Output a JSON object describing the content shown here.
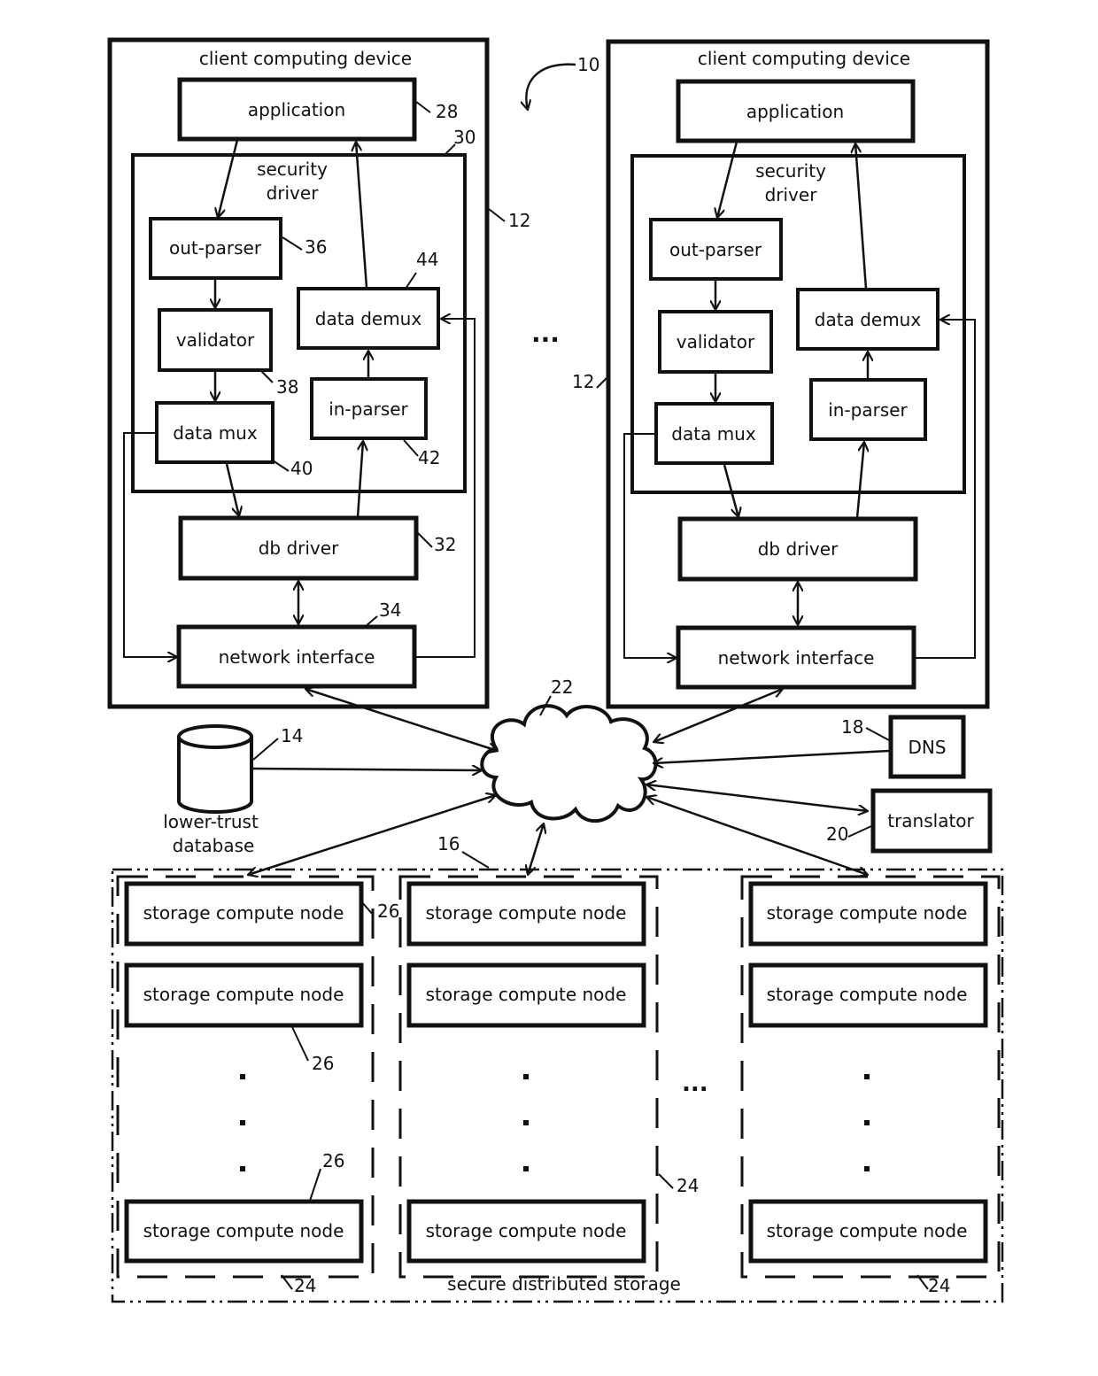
{
  "figure_ref": "10",
  "client_left": {
    "title": "client computing device",
    "ref": "12",
    "application": {
      "label": "application",
      "ref": "28"
    },
    "security_driver": {
      "label_line1": "security",
      "label_line2": "driver",
      "ref": "30"
    },
    "out_parser": {
      "label": "out-parser",
      "ref": "36"
    },
    "validator": {
      "label": "validator",
      "ref": "38"
    },
    "data_mux": {
      "label": "data mux",
      "ref": "40"
    },
    "in_parser": {
      "label": "in-parser",
      "ref": "42"
    },
    "data_demux": {
      "label": "data demux",
      "ref": "44"
    },
    "db_driver": {
      "label": "db driver",
      "ref": "32"
    },
    "network_interface": {
      "label": "network interface",
      "ref": "34"
    }
  },
  "client_right": {
    "title": "client computing device",
    "ref": "12",
    "application": {
      "label": "application"
    },
    "security_driver": {
      "label_line1": "security",
      "label_line2": "driver"
    },
    "out_parser": {
      "label": "out-parser"
    },
    "validator": {
      "label": "validator"
    },
    "data_mux": {
      "label": "data mux"
    },
    "in_parser": {
      "label": "in-parser"
    },
    "data_demux": {
      "label": "data demux"
    },
    "db_driver": {
      "label": "db driver"
    },
    "network_interface": {
      "label": "network interface"
    }
  },
  "ellipsis": "...",
  "network": {
    "ref": "22"
  },
  "database": {
    "label_line1": "lower-trust",
    "label_line2": "database",
    "ref": "14"
  },
  "dns": {
    "label": "DNS",
    "ref": "18"
  },
  "translator": {
    "label": "translator",
    "ref": "20"
  },
  "storage": {
    "label": "secure distributed storage",
    "ref": "16",
    "domain_ref": "24",
    "node_ref": "26",
    "node_label": "storage compute node",
    "columns": [
      {
        "nodes": [
          "storage compute node",
          "storage compute node",
          "storage compute node"
        ]
      },
      {
        "nodes": [
          "storage compute node",
          "storage compute node",
          "storage compute node"
        ]
      },
      {
        "nodes": [
          "storage compute node",
          "storage compute node",
          "storage compute node"
        ]
      }
    ]
  }
}
